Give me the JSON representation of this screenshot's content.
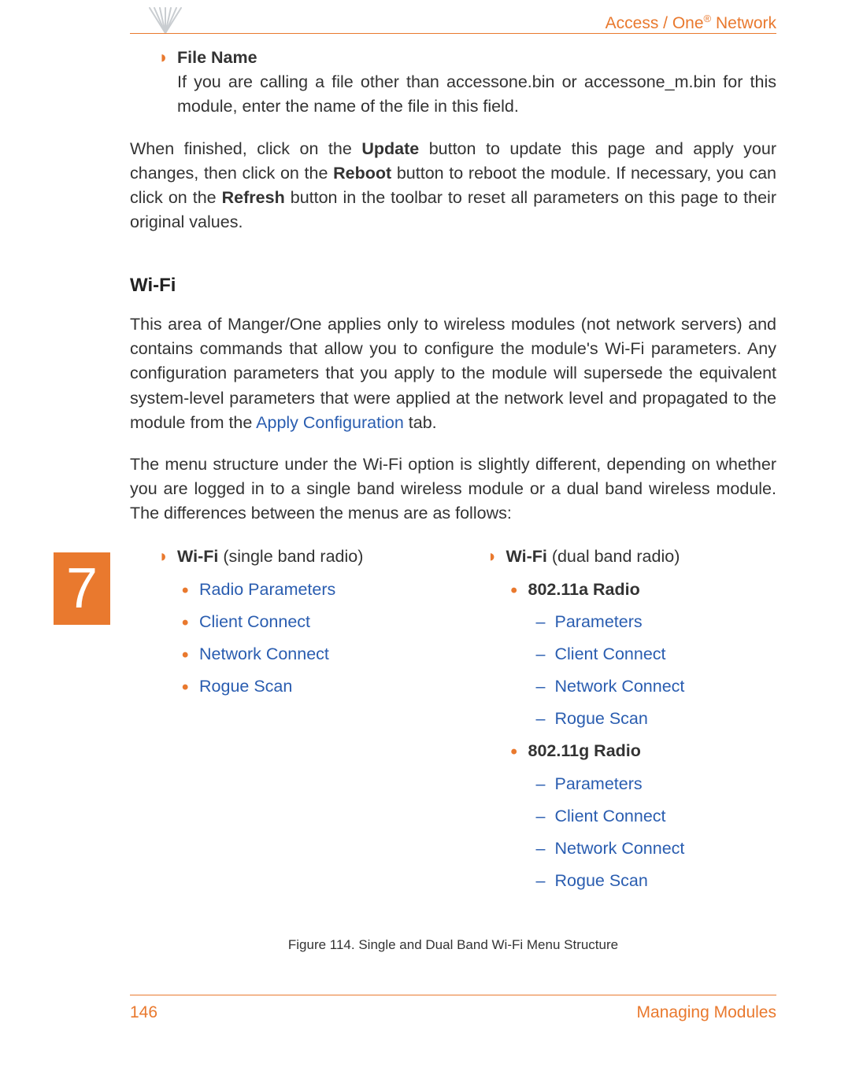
{
  "header": {
    "brand_prefix": "Access / One",
    "brand_suffix": " Network",
    "reg": "®"
  },
  "file_name_section": {
    "title": "File Name",
    "body": "If you are calling a file other than accessone.bin or accessone_m.bin for this module, enter the name of the file in this field."
  },
  "update_para": {
    "p1a": "When finished, click on the ",
    "update": "Update",
    "p1b": " button to update this page and apply your changes, then click on the ",
    "reboot": "Reboot",
    "p1c": " button to reboot the module. If necessary, you can click on the ",
    "refresh": "Refresh",
    "p1d": " button in the toolbar to reset all parameters on this page to their original values."
  },
  "wifi_section": {
    "title": "Wi-Fi",
    "p1a": "This area of Manger/One applies only to wireless modules (not network servers) and contains commands that allow you to configure the module's Wi-Fi parameters. Any configuration parameters that you apply to the module will supersede the equivalent system-level parameters that were applied at the network level and propagated to the module from the ",
    "link": "Apply Configuration",
    "p1b": " tab.",
    "p2": "The menu structure under the Wi-Fi option is slightly different, depending on whether you are logged in to a single band wireless module or a dual band wireless module. The differences between the menus are as follows:"
  },
  "menu_columns": {
    "left": {
      "heading_bold": "Wi-Fi",
      "heading_rest": " (single band radio)",
      "items": [
        "Radio Parameters",
        "Client Connect",
        "Network Connect",
        "Rogue Scan"
      ]
    },
    "right": {
      "heading_bold": "Wi-Fi",
      "heading_rest": " (dual band radio)",
      "radio_a": "802.11a Radio",
      "radio_g": "802.11g Radio",
      "sub_items": [
        "Parameters",
        "Client Connect",
        "Network Connect",
        "Rogue Scan"
      ]
    }
  },
  "figure_caption": "Figure 114. Single and Dual Band Wi-Fi Menu Structure",
  "chapter_number": "7",
  "footer": {
    "page": "146",
    "title": "Managing Modules"
  }
}
